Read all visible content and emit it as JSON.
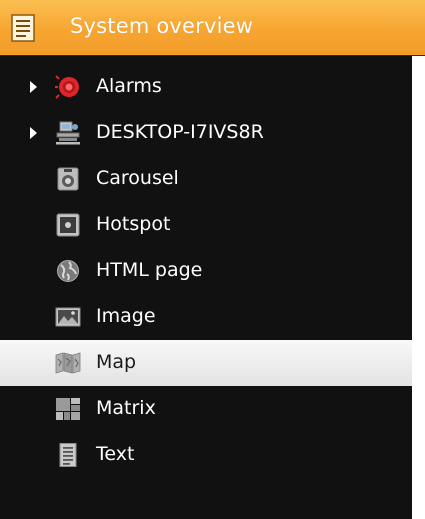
{
  "header": {
    "title": "System overview",
    "icon": "list-icon"
  },
  "colors": {
    "header_accent": "#f7a531",
    "tree_background": "#111111",
    "selected_row": "#e8e8e8",
    "alarm_red": "#e0252b"
  },
  "tree": {
    "items": [
      {
        "label": "Alarms",
        "icon": "alarm-icon",
        "expandable": true
      },
      {
        "label": "DESKTOP-I7IVS8R",
        "icon": "server-icon",
        "expandable": true
      },
      {
        "label": "Carousel",
        "icon": "carousel-icon",
        "expandable": false
      },
      {
        "label": "Hotspot",
        "icon": "hotspot-icon",
        "expandable": false
      },
      {
        "label": "HTML page",
        "icon": "globe-icon",
        "expandable": false
      },
      {
        "label": "Image",
        "icon": "image-icon",
        "expandable": false
      },
      {
        "label": "Map",
        "icon": "map-icon",
        "expandable": false,
        "selected": true
      },
      {
        "label": "Matrix",
        "icon": "matrix-icon",
        "expandable": false
      },
      {
        "label": "Text",
        "icon": "text-document-icon",
        "expandable": false
      }
    ]
  }
}
